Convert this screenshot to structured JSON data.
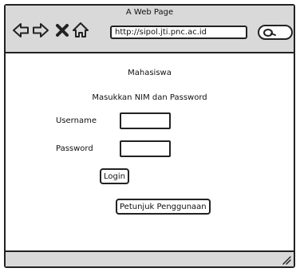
{
  "window": {
    "title": "A Web Page"
  },
  "toolbar": {
    "icons": [
      "back-arrow-icon",
      "forward-arrow-icon",
      "close-icon",
      "home-icon",
      "search-icon"
    ],
    "url": "http://sipol.jti.pnc.ac.id"
  },
  "form": {
    "heading": "Mahasiswa",
    "instruction": "Masukkan NIM dan Password",
    "username_label": "Username",
    "username_value": "",
    "password_label": "Password",
    "password_value": "",
    "login_label": "Login",
    "help_label": "Petunjuk Penggunaan"
  }
}
